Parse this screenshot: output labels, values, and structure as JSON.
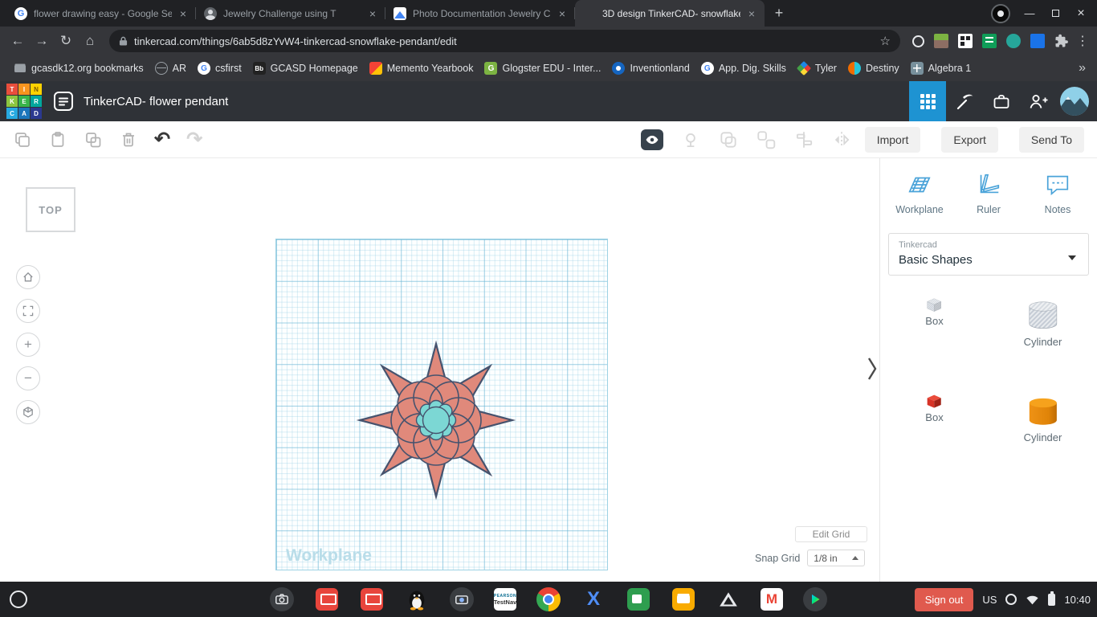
{
  "glyphs": {
    "google_g": "G",
    "gmail": "M",
    "x_app": "X"
  },
  "browser": {
    "tabs": [
      {
        "title": "flower drawing easy - Google Se",
        "favicon": "google-g"
      },
      {
        "title": "Jewelry Challenge using T",
        "favicon": "person"
      },
      {
        "title": "Photo Documentation Jewelry C",
        "favicon": "photo"
      },
      {
        "title": "3D design TinkerCAD- snowflake",
        "favicon": "tinkercad",
        "active": true
      }
    ],
    "new_tab_glyph": "+",
    "address": {
      "url": "tinkercad.com/things/6ab5d8zYvW4-tinkercad-snowflake-pendant/edit"
    },
    "bookmarks": [
      {
        "label": "gcasdk12.org bookmarks",
        "icon": "folder"
      },
      {
        "label": "AR",
        "icon": "globe"
      },
      {
        "label": "csfirst",
        "icon": "google-g",
        "icon_text": "G"
      },
      {
        "label": "GCASD Homepage",
        "icon": "blackboard",
        "icon_text": "Bb"
      },
      {
        "label": "Memento Yearbook",
        "icon": "camera"
      },
      {
        "label": "Glogster EDU - Inter...",
        "icon": "glogster",
        "icon_text": "G"
      },
      {
        "label": "Inventionland",
        "icon": "inventionland"
      },
      {
        "label": "App. Dig. Skills",
        "icon": "google-g",
        "icon_text": "G"
      },
      {
        "label": "Tyler",
        "icon": "sparkle"
      },
      {
        "label": "Destiny",
        "icon": "destiny"
      },
      {
        "label": "Algebra 1",
        "icon": "grid"
      }
    ],
    "bookmarks_overflow": "»"
  },
  "app_header": {
    "title": "TinkerCAD- flower pendant"
  },
  "toolbar": {
    "import": "Import",
    "export": "Export",
    "send_to": "Send To"
  },
  "sidebar": {
    "tools": [
      {
        "label": "Workplane"
      },
      {
        "label": "Ruler"
      },
      {
        "label": "Notes"
      }
    ],
    "library": {
      "brand": "Tinkercad",
      "selected": "Basic Shapes"
    },
    "shapes": [
      {
        "label": "Box",
        "variant": "striped-box"
      },
      {
        "label": "Cylinder",
        "variant": "striped-cylinder"
      },
      {
        "label": "Box",
        "variant": "red-box"
      },
      {
        "label": "Cylinder",
        "variant": "orange-cylinder"
      }
    ]
  },
  "canvas": {
    "view_cube": "TOP",
    "workplane_watermark": "Workplane",
    "edit_grid": "Edit Grid",
    "snap_grid_label": "Snap Grid",
    "snap_grid_value": "1/8 in",
    "pendant_colors": {
      "body": "#e0897b",
      "center": "#7cd7d4",
      "outline": "#46536e"
    }
  },
  "shelf": {
    "sign_out": "Sign out",
    "keyboard": "US",
    "time": "10:40",
    "testnav": {
      "brand": "PEARSON",
      "name": "TestNav"
    }
  }
}
